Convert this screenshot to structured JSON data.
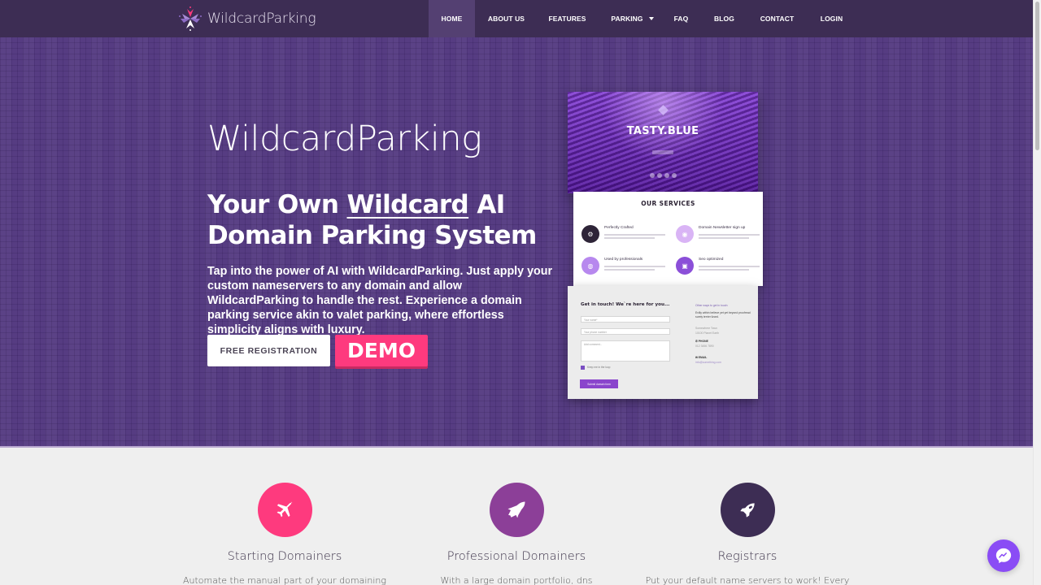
{
  "navbar": {
    "brand": "WildcardParking",
    "items": [
      {
        "label": "HOME",
        "active": true
      },
      {
        "label": "ABOUT US"
      },
      {
        "label": "FEATURES"
      },
      {
        "label": "PARKING",
        "has_dropdown": true
      },
      {
        "label": "FAQ"
      },
      {
        "label": "BLOG"
      },
      {
        "label": "CONTACT"
      },
      {
        "label": "LOGIN"
      }
    ]
  },
  "hero": {
    "brand": "WildcardParking",
    "title_part1": "Your Own ",
    "title_underlined": "Wildcard",
    "title_part2": " AI Domain Parking System",
    "description": "Tap into the power of AI with WildcardParking. Just apply your custom nameservers to any domain and allow WildcardParking to handle the rest. Experience a domain parking service akin to valet parking, where effortless simplicity aligns with luxury.",
    "register_button": "FREE REGISTRATION",
    "demo_button": "DEMO"
  },
  "mockup": {
    "landing_title": "TASTY.BLUE",
    "services_title": "OUR  SERVICES",
    "services": [
      {
        "title": "Perfectly Crafted",
        "icon": "gears-icon"
      },
      {
        "title": "Domain Newsletter sign up",
        "icon": "newsletter-icon"
      },
      {
        "title": "Used by professionals",
        "icon": "globe-icon"
      },
      {
        "title": "Seo optimized",
        "icon": "chart-board-icon"
      }
    ],
    "contact": {
      "title": "Get in touch! We`re here for you...",
      "name_placeholder": "Your name*",
      "phone_placeholder": "Your phone number",
      "comments_placeholder": "Add comment...",
      "checkbox_label": "Keep me in the loop",
      "submit_label": "Submit domain form",
      "side_heading": "Other ways to get in touch:",
      "side_text": "Evilly within believe yet yet beyond proofread surely terrier lizard.",
      "address_line1": "Somewhere Town",
      "address_line2": "10100 Planet Earth",
      "phone_label": "PHONE",
      "phone_value": "012 3456 7890",
      "email_label": "EMAIL",
      "email_value": "info@something.com"
    }
  },
  "features": [
    {
      "title": "Starting Domainers",
      "description": "Automate the manual part of your domaining",
      "color": "#fe3a7e",
      "icon": "airplane-icon"
    },
    {
      "title": "Professional Domainers",
      "description": "With a large domain portfolio, dns",
      "color": "#8c3f98",
      "icon": "space-shuttle-icon"
    },
    {
      "title": "Registrars",
      "description": "Put your default name servers to work! Every",
      "color": "#3d2d54",
      "icon": "rocket-icon"
    }
  ],
  "colors": {
    "navbar": "#3d2d54",
    "hero_bg": "#563c82",
    "accent_pink": "#fe3a7e",
    "messenger": "#8a4cf5"
  }
}
